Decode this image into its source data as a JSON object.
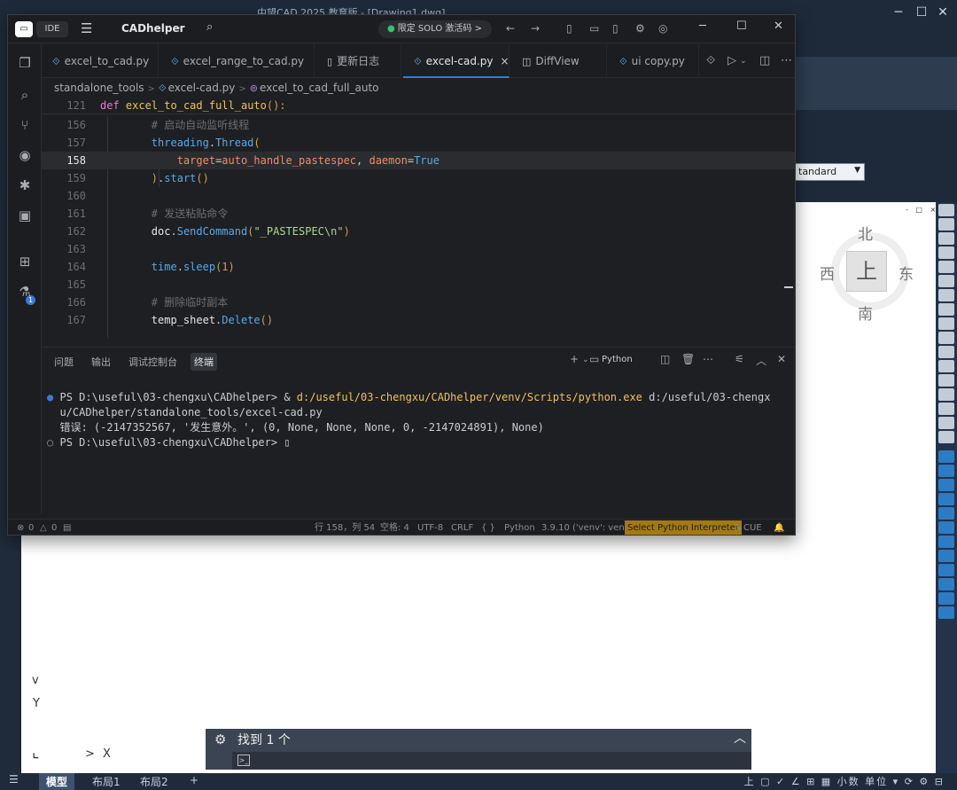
{
  "cad": {
    "title": "中望CAD 2025 教育版 - [Drawing1.dwg]",
    "style_select": "tandard",
    "compass": {
      "north": "北",
      "south": "南",
      "west": "西",
      "east": "东",
      "face": "上"
    },
    "canvas_controls": "- □ ×",
    "search": {
      "found_label": "找到",
      "found_count": "1",
      "found_unit": "个"
    },
    "ucs": {
      "y": "Y",
      "x": "X",
      "arrow_up": "^",
      "arrow_down": "v"
    },
    "layout_tabs": [
      "模型",
      "布局1",
      "布局2",
      "+"
    ],
    "status_right": "上 ▢ ✓ ∠ ⊞ ▦ 小数 单位 ▾ ⟳ ⚙ ⊟"
  },
  "ide": {
    "mode": "IDE",
    "project": "CADhelper",
    "promo": "限定 SOLO 激活码 >",
    "tabs": [
      {
        "label": "excel_to_cad.py",
        "active": false
      },
      {
        "label": "excel_range_to_cad.py",
        "active": false
      },
      {
        "label": "更新日志",
        "active": false
      },
      {
        "label": "excel-cad.py",
        "active": true
      },
      {
        "label": "DiffView",
        "active": false
      },
      {
        "label": "ui copy.py",
        "active": false
      }
    ],
    "tab_close": "×",
    "breadcrumb": [
      "standalone_tools",
      "excel-cad.py",
      "excel_to_cad_full_auto"
    ],
    "sticky": {
      "line": "121",
      "kw": "def",
      "fn": "excel_to_cad_full_auto",
      "rest": "():"
    },
    "code": [
      {
        "line": "156",
        "comment": "# 启动自动监听线程"
      },
      {
        "line": "157",
        "obj": "threading",
        "dot": ".",
        "attr": "Thread",
        "pun": "("
      },
      {
        "line": "158",
        "param1": "target",
        "eq1": "=",
        "val1": "auto_handle_pastespec",
        "comma": ", ",
        "param2": "daemon",
        "eq2": "=",
        "val2": "True"
      },
      {
        "line": "159",
        "pun": ")",
        "dot": ".",
        "attr": "start",
        "paren": "()"
      },
      {
        "line": "160"
      },
      {
        "line": "161",
        "comment": "# 发送粘贴命令"
      },
      {
        "line": "162",
        "obj": "doc",
        "dot": ".",
        "attr": "SendCommand",
        "pun_open": "(",
        "str": "\"_PASTESPEC\\n\"",
        "pun_close": ")"
      },
      {
        "line": "163"
      },
      {
        "line": "164",
        "obj": "time",
        "dot": ".",
        "attr": "sleep",
        "pun_open": "(",
        "num": "1",
        "pun_close": ")"
      },
      {
        "line": "165"
      },
      {
        "line": "166",
        "comment": "# 删除临时副本"
      },
      {
        "line": "167",
        "obj": "temp_sheet",
        "dot": ".",
        "attr": "Delete",
        "paren": "()"
      }
    ],
    "panel_tabs": [
      "问题",
      "输出",
      "调试控制台",
      "终端"
    ],
    "panel_active": "终端",
    "panel_python": "Python",
    "terminal": {
      "prompt1": "PS D:\\useful\\03-chengxu\\CADhelper> & ",
      "cmd1": "d:/useful/03-chengxu/CADhelper/venv/Scripts/python.exe",
      "arg1a": " d:/useful/03-chengx",
      "arg1b": "u/CADhelper/standalone_tools/excel-cad.py",
      "error": "错误: (-2147352567, '发生意外。', (0, None, None, None, 0, -2147024891), None)",
      "prompt2": "PS D:\\useful\\03-chengxu\\CADhelper> "
    },
    "status": {
      "errors": "0",
      "warnings": "0",
      "position": "行 158，列 54",
      "spaces": "空格: 4",
      "encoding": "UTF-8",
      "eol": "CRLF",
      "braces": "{ }",
      "language": "Python",
      "version": "3.9.10 ('venv': venv)",
      "interpreter": "Select Python Interpreter",
      "cue": "CUE"
    }
  }
}
